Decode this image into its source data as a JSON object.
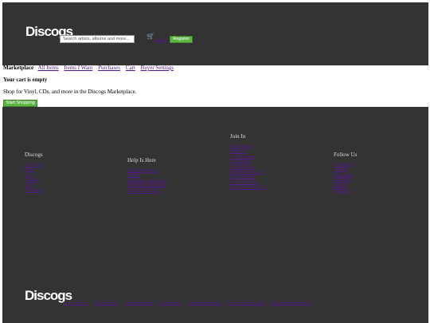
{
  "header": {
    "logo": "Discogs",
    "search_placeholder": "Search artists, albums and more...",
    "cart_icon": "cart-icon",
    "login_label": "Log In",
    "register_label": "Register"
  },
  "nav": {
    "title": "Marketplace",
    "links": [
      "All Items",
      "Items I Want",
      "Purchases",
      "Cart",
      "Buyer Settings"
    ]
  },
  "main": {
    "empty_title": "Your cart is empty",
    "shop_text": "Shop for Vinyl, CDs, and more in the Discogs Marketplace.",
    "start_button": "Start Shopping"
  },
  "footer": {
    "col1": {
      "title": "Discogs",
      "links": [
        "About Us",
        "Blog",
        "Jobs",
        "Careers",
        "API",
        "Affiliates"
      ]
    },
    "col2": {
      "title": "Help Is Here",
      "links": [
        "Help & Support",
        "Forum",
        "Database Guidelines",
        "Shipping Guidelines",
        "Report Violation"
      ]
    },
    "col3": {
      "title": "Join In",
      "links": [
        "Get Started",
        "Sign Up",
        "Discogs Plus",
        "Contribute",
        "Add Release",
        "Submission Lists",
        "Data Tutorial",
        "Record Stores",
        "Advertise With Us"
      ]
    },
    "col4": {
      "title": "Follow Us",
      "links": [
        "Facebook",
        "Twitter",
        "Instagram",
        "YouTube",
        "Reddit",
        "Pinterest"
      ]
    }
  },
  "bottom": {
    "logo": "Discogs",
    "links": [
      "Cookie Policy",
      "Privacy Policy",
      "User Agreement",
      "Accessibility",
      "Cookie Preferences",
      "Do Not Sell My Info",
      "Community Guidelines"
    ]
  }
}
